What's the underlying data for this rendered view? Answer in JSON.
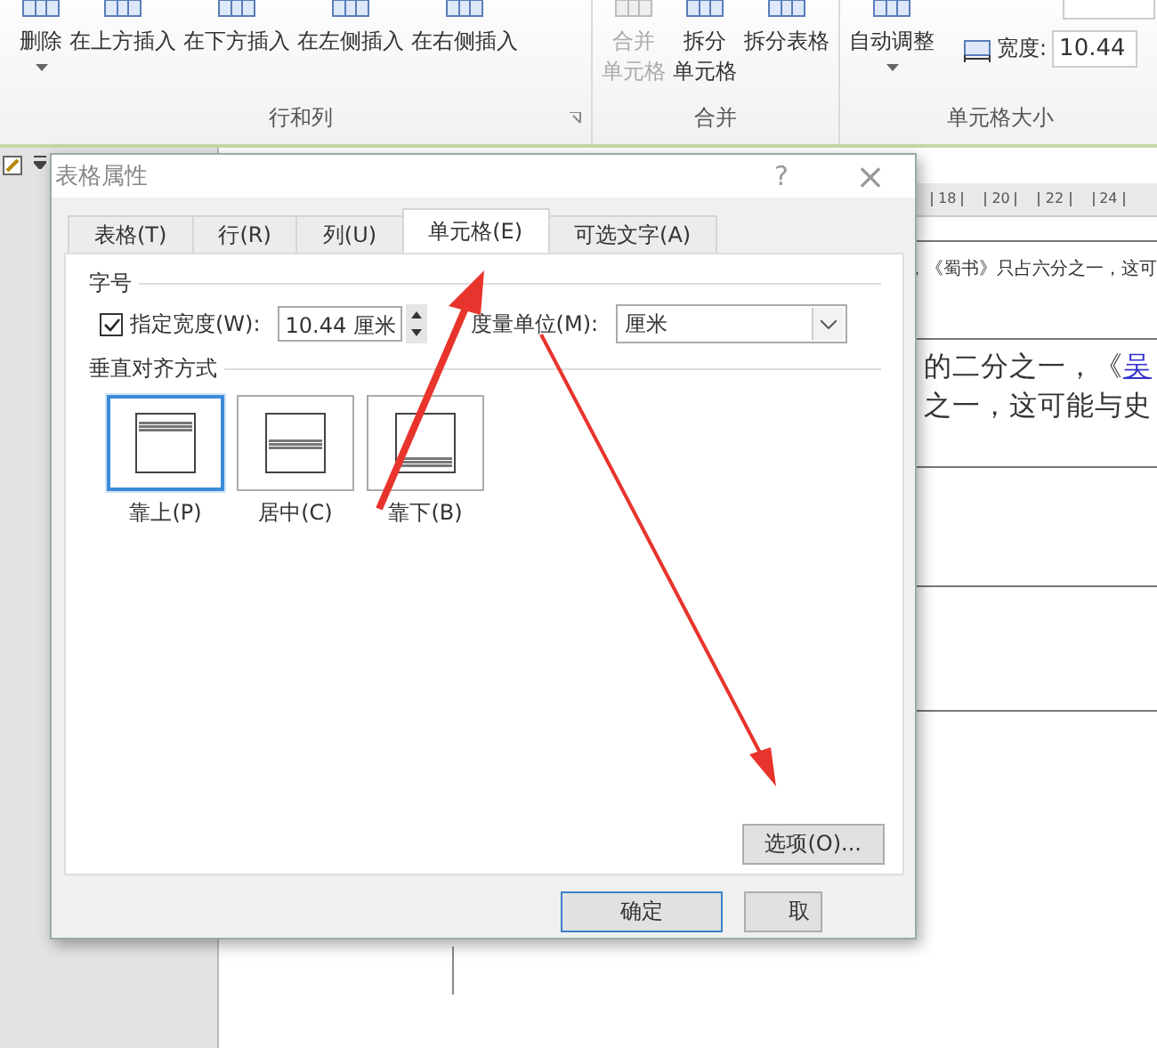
{
  "ribbon": {
    "groups": [
      {
        "label": "行和列",
        "launcher": true,
        "buttons": [
          {
            "label": "删除",
            "dropdown": true,
            "disabled": false
          },
          {
            "label": "在上方插入",
            "dropdown": false,
            "disabled": false
          },
          {
            "label": "在下方插入",
            "dropdown": false,
            "disabled": false
          },
          {
            "label": "在左侧插入",
            "dropdown": false,
            "disabled": false
          },
          {
            "label": "在右侧插入",
            "dropdown": false,
            "disabled": false
          }
        ]
      },
      {
        "label": "合并",
        "launcher": false,
        "buttons": [
          {
            "label": [
              "合并",
              "单元格"
            ],
            "dropdown": false,
            "disabled": true
          },
          {
            "label": [
              "拆分",
              "单元格"
            ],
            "dropdown": false,
            "disabled": false
          },
          {
            "label": "拆分表格",
            "dropdown": false,
            "disabled": false
          }
        ]
      },
      {
        "label": "单元格大小",
        "launcher": false,
        "buttons": [
          {
            "label": "自动调整",
            "dropdown": true,
            "disabled": false
          }
        ],
        "width_label": "宽度:",
        "width_value": "10.44"
      }
    ]
  },
  "ruler": [
    "18",
    "20",
    "22",
    "24"
  ],
  "document": {
    "small_line": "，《蜀书》只占六分之一，这可",
    "lines": [
      {
        "text": "的二分之一，《",
        "link": "吴"
      },
      {
        "text": "之一，这可能与史"
      }
    ]
  },
  "dialog": {
    "title": "表格属性",
    "help": "?",
    "close": "×",
    "tabs": [
      {
        "label": "表格(T)",
        "selected": false
      },
      {
        "label": "行(R)",
        "selected": false
      },
      {
        "label": "列(U)",
        "selected": false
      },
      {
        "label": "单元格(E)",
        "selected": true
      },
      {
        "label": "可选文字(A)",
        "selected": false
      }
    ],
    "size_section": "字号",
    "width_checkbox": {
      "label": "指定宽度(W):",
      "checked": true
    },
    "width_value": "10.44 厘米",
    "unit_label": "度量单位(M):",
    "unit_value": "厘米",
    "align_section": "垂直对齐方式",
    "align_options": [
      {
        "kind": "top",
        "label": "靠上(P)",
        "selected": true
      },
      {
        "kind": "center",
        "label": "居中(C)",
        "selected": false
      },
      {
        "kind": "bottom",
        "label": "靠下(B)",
        "selected": false
      }
    ],
    "options_button": "选项(O)...",
    "ok_button": "确定",
    "cancel_button": "取"
  },
  "annotations": [
    {
      "kind": "arrow"
    },
    {
      "kind": "arrow"
    }
  ]
}
